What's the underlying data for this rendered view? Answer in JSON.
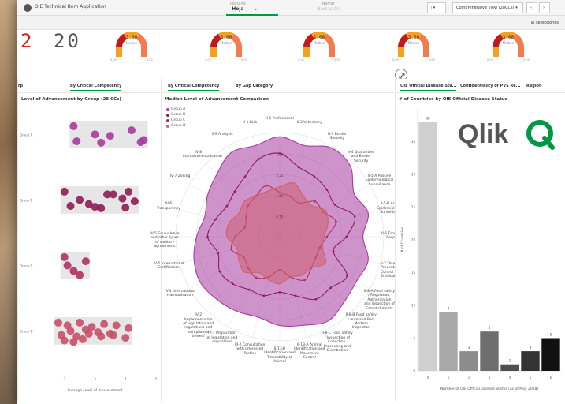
{
  "window": {
    "title": "OIE Technical Item Application"
  },
  "nav": {
    "items": [
      {
        "label": "Pestaña",
        "value": "Hoja",
        "active": true
      },
      {
        "label": "Narrar",
        "value": "Narración",
        "active": false
      }
    ],
    "view_select": "Comprehensive view (28CCs)",
    "selections_label": "Selecciones"
  },
  "kpis": {
    "digits": [
      "2",
      "20"
    ],
    "gauges": [
      {
        "value": "3.00",
        "label": "Median",
        "min": "0.00",
        "max": "5.00"
      },
      {
        "value": "3.00",
        "label": "Median",
        "min": "0.00",
        "max": "5.00"
      },
      {
        "value": "2.00",
        "label": "Median",
        "min": "0.00",
        "max": "5.00"
      },
      {
        "value": "3.00",
        "label": "Median",
        "min": "0.00",
        "max": "5.00"
      },
      {
        "value": "3.00",
        "label": "Median",
        "min": "0.00",
        "max": "5.00"
      }
    ]
  },
  "left_panel": {
    "tabs": [
      "rp",
      "By Critical Competency"
    ],
    "title": "Level of Advancement by Group (28 CCs)",
    "xlabel": "Average Level of Advancement",
    "groups": [
      "Group A",
      "Group B",
      "Group C",
      "Group D"
    ]
  },
  "mid_panel": {
    "tabs": [
      "By Critical Competency",
      "By Gap Category"
    ],
    "title": "Median Level of Advancement Comparison",
    "legend": [
      "Group A",
      "Group B",
      "Group C",
      "Group D"
    ],
    "ring_labels": [
      "0.75",
      "1.50",
      "2.25",
      "3.00"
    ],
    "axes": [
      "II-1 Professional",
      "II-2 Veterinary",
      "II-3 Border Security",
      "II-4 Quarantine and Border Security",
      "II-5-A Passive Epidemiological Surveillance",
      "II-5-B Active Epidemiological Surveillance",
      "II-6 Emergency Response",
      "II-7 Disease Prevention, Control and Eradication",
      "II-8-A Food safety / Regulation, Authorization and Inspection of Establishments",
      "II-8-B Food safety / Ante and Post Mortem Inspection",
      "II-8-C Food safety / Inspection of Collection, Processing and Distribution",
      "II-13-A Animal Identification and Movement Control",
      "II-13-B Identification and Traceability of Animal",
      "III-2 Consultation with Interested Parties",
      "IV-1 Preparation of legislation and regulations",
      "IV-2 Implementation of legislation and regulations and compliance thereof",
      "IV-4 International Harmonisation",
      "IV-5 International Certification",
      "IV-5 Equivalence and other types of sanitary agreements",
      "IV-6 Transparency",
      "IV-7 Zoning",
      "IV-8 Compartmentalisation",
      "II-9 Analysis",
      "II-1 Risk"
    ]
  },
  "right_panel": {
    "tabs": [
      "OIE Official Disease Sta...",
      "Confidentiality of PVS Re...",
      "Region"
    ],
    "title": "# of Countries by OIE Official Disease Status",
    "ylabel": "# of Countries",
    "xlabel": "Number of OIE Official Disease Status (as of May 2018)",
    "logo_text": "Qlik"
  },
  "chart_data": [
    {
      "type": "scatter",
      "title": "Level of Advancement by Group (28 CCs)",
      "xlabel": "Average Level of Advancement",
      "ylabel": "",
      "xlim": [
        1,
        5
      ],
      "x_ticks": [
        "2",
        "3",
        "4",
        "5"
      ],
      "categories": [
        "Group A",
        "Group B",
        "Group C",
        "Group D"
      ],
      "series": [
        {
          "name": "Group A",
          "color": "#a83aa0",
          "x": [
            2.3,
            3.0,
            4.2,
            2.4,
            3.5,
            3.2,
            4.6,
            4.5
          ],
          "jitter": [
            0.2,
            0.5,
            0.35,
            0.75,
            0.55,
            0.8,
            0.7,
            0.78
          ]
        },
        {
          "name": "Group B",
          "color": "#8e1d55",
          "x": [
            2.0,
            2.5,
            3.0,
            3.6,
            4.1,
            4.3,
            3.2,
            2.8,
            3.9,
            4.0,
            2.2,
            3.4
          ],
          "jitter": [
            0.2,
            0.5,
            0.75,
            0.3,
            0.2,
            0.55,
            0.8,
            0.65,
            0.45,
            0.78,
            0.72,
            0.3
          ]
        },
        {
          "name": "Group C",
          "color": "#b03060",
          "x": [
            2.0,
            2.1,
            2.3,
            2.7,
            2.5
          ],
          "jitter": [
            0.2,
            0.5,
            0.7,
            0.35,
            0.85
          ]
        },
        {
          "name": "Group D",
          "color": "#c85068",
          "x": [
            1.8,
            2.1,
            2.5,
            2.9,
            3.3,
            3.7,
            4.1,
            2.2,
            2.7,
            3.1,
            3.5,
            1.9,
            2.4,
            2.8,
            3.2,
            3.6,
            4.0,
            2.0,
            2.3,
            2.6
          ],
          "jitter": [
            0.2,
            0.3,
            0.2,
            0.35,
            0.25,
            0.3,
            0.4,
            0.5,
            0.45,
            0.55,
            0.6,
            0.65,
            0.7,
            0.6,
            0.7,
            0.65,
            0.75,
            0.85,
            0.9,
            0.8
          ]
        }
      ]
    },
    {
      "type": "radar",
      "title": "Median Level of Advancement Comparison",
      "rmax": 3.75,
      "rings": [
        0.75,
        1.5,
        2.25,
        3.0,
        3.75
      ],
      "series": [
        {
          "name": "Group A",
          "color": "#a83aa0",
          "fill": true,
          "values": [
            3.6,
            3.4,
            3.7,
            3.6,
            3.1,
            3.3,
            3.0,
            3.3,
            3.2,
            3.3,
            3.5,
            3.3,
            3.2,
            3.0,
            3.1,
            3.2,
            3.3,
            3.2,
            3.0,
            2.8,
            3.0,
            3.2,
            3.5,
            3.4
          ]
        },
        {
          "name": "Group B",
          "color": "#8e1d55",
          "fill": false,
          "values": [
            3.0,
            2.6,
            2.5,
            2.4,
            2.3,
            2.8,
            2.4,
            2.0,
            2.8,
            2.6,
            2.6,
            2.2,
            2.0,
            2.2,
            2.2,
            2.4,
            2.5,
            2.3,
            2.6,
            2.4,
            2.2,
            2.3,
            2.5,
            2.9
          ]
        },
        {
          "name": "Group C",
          "color": "#b03060",
          "fill": false,
          "values": [
            1.6,
            1.5,
            1.4,
            1.8,
            1.8,
            2.1,
            1.7,
            1.5,
            1.5,
            1.6,
            1.8,
            1.5,
            1.2,
            1.5,
            1.7,
            1.6,
            1.5,
            1.8,
            1.6,
            1.3,
            1.4,
            1.6,
            1.7,
            1.9
          ]
        },
        {
          "name": "Group D",
          "color": "#d06070",
          "fill": true,
          "values": [
            1.8,
            2.0,
            1.7,
            1.6,
            1.9,
            1.8,
            1.6,
            1.6,
            1.9,
            1.6,
            1.6,
            1.5,
            1.7,
            1.6,
            1.5,
            1.8,
            1.7,
            1.6,
            1.9,
            1.9,
            1.7,
            1.8,
            1.7,
            1.7
          ]
        }
      ]
    },
    {
      "type": "bar",
      "title": "# of Countries by OIE Official Disease Status",
      "xlabel": "Number of OIE Official Disease Status (as of May 2018)",
      "ylabel": "# of Countries",
      "categories": [
        "0",
        "1",
        "2",
        "3",
        "4",
        "5",
        "6"
      ],
      "values": [
        38,
        9,
        3,
        6,
        1,
        3,
        5
      ],
      "colors": [
        "#cfcfcf",
        "#a8a8a8",
        "#8c8c8c",
        "#6e6e6e",
        "#4f4f4f",
        "#333333",
        "#111111"
      ],
      "ylim": [
        0,
        40
      ],
      "y_ticks": [
        "0",
        "5",
        "10",
        "15",
        "20",
        "25",
        "30",
        "35"
      ]
    }
  ]
}
